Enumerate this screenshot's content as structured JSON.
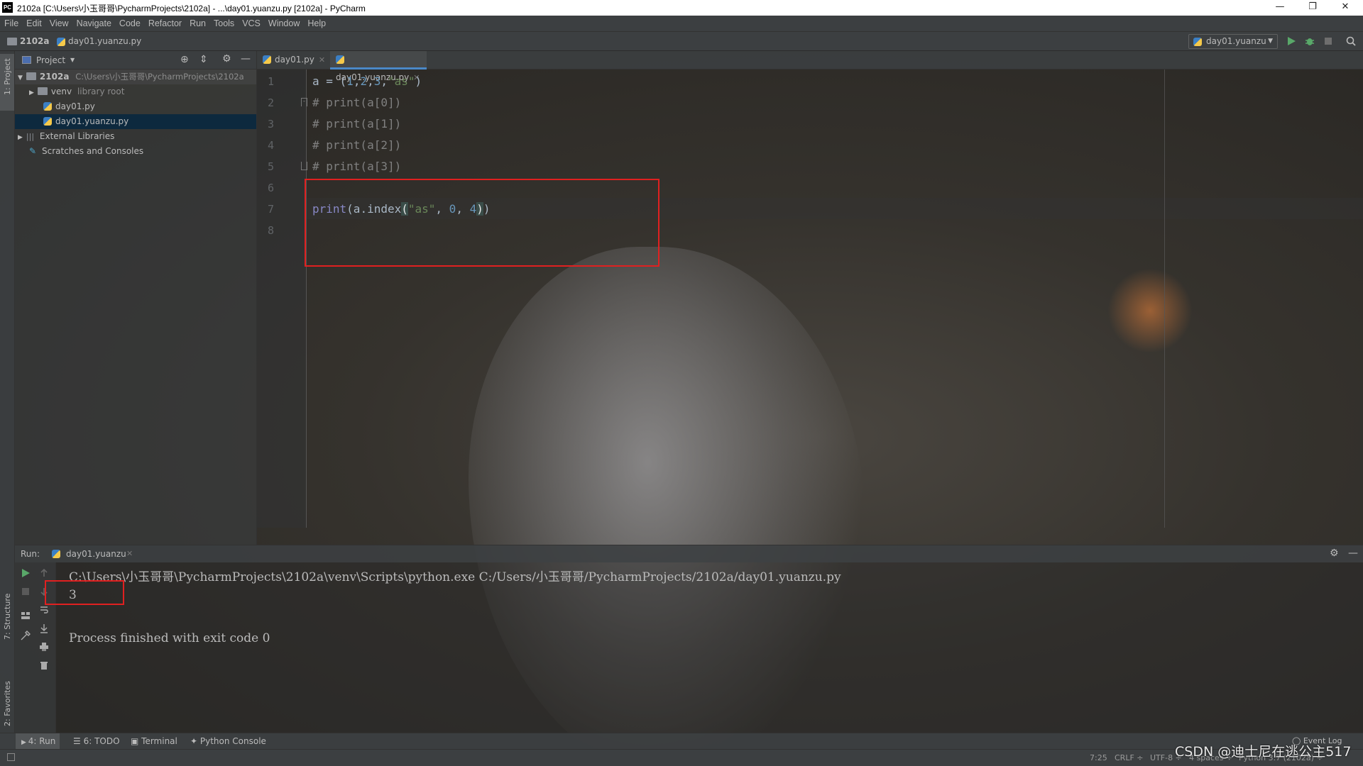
{
  "window": {
    "app_logo": "PC",
    "title": "2102a [C:\\Users\\小玉哥哥\\PycharmProjects\\2102a] - ...\\day01.yuanzu.py [2102a] - PyCharm",
    "minimize": "—",
    "restore": "❐",
    "close": "✕"
  },
  "menu": [
    "File",
    "Edit",
    "View",
    "Navigate",
    "Code",
    "Refactor",
    "Run",
    "Tools",
    "VCS",
    "Window",
    "Help"
  ],
  "navbar": {
    "project": "2102a",
    "file": "day01.yuanzu.py",
    "run_config": "day01.yuanzu",
    "icons": [
      "run-icon",
      "debug-icon",
      "stop-icon",
      "search-icon"
    ]
  },
  "left_strip": {
    "project_tab": "1: Project",
    "structure_tab": "7: Structure",
    "favorites_tab": "2: Favorites"
  },
  "project_panel": {
    "title": "Project",
    "tree": [
      {
        "label": "2102a",
        "extra": "C:\\Users\\小玉哥哥\\PycharmProjects\\2102a",
        "type": "folder",
        "expanded": true
      },
      {
        "label": "venv",
        "extra": "library root",
        "type": "folder",
        "expanded": false
      },
      {
        "label": "day01.py",
        "extra": "",
        "type": "python-file"
      },
      {
        "label": "day01.yuanzu.py",
        "extra": "",
        "type": "python-file",
        "selected": true
      },
      {
        "label": "External Libraries",
        "extra": "",
        "type": "libraries",
        "expanded": false
      },
      {
        "label": "Scratches and Consoles",
        "extra": "",
        "type": "scratches"
      }
    ]
  },
  "editor": {
    "tabs": [
      {
        "label": "day01.py",
        "active": false
      },
      {
        "label": "day01.yuanzu.py",
        "active": true
      }
    ],
    "line_numbers": [
      "1",
      "2",
      "3",
      "4",
      "5",
      "6",
      "7",
      "8"
    ],
    "code": {
      "l1": {
        "a": "a = (",
        "n1": "1",
        "c1": ",",
        "n2": "2",
        "c2": ",",
        "n3": "3",
        "c3": ",",
        "s": "\"as\"",
        "close": ")"
      },
      "l2": "# print(a[0])",
      "l3": "# print(a[1])",
      "l4": "# print(a[2])",
      "l5": "# print(a[3])",
      "l7": {
        "fn": "print",
        "mid": "(a.index",
        "open": "(",
        "s": "\"as\"",
        "c": ", ",
        "n0": "0",
        "c2": ", ",
        "n4": "4",
        "close1": ")",
        "close2": ")"
      }
    },
    "cursor_position": "7:25",
    "highlight_color": "#e02020"
  },
  "run_panel": {
    "label": "Run:",
    "tab": "day01.yuanzu",
    "command": "C:\\Users\\小玉哥哥\\PycharmProjects\\2102a\\venv\\Scripts\\python.exe C:/Users/小玉哥哥/PycharmProjects/2102a/day01.yuanzu.py",
    "result": "3",
    "exit_message": "Process finished with exit code 0"
  },
  "bottom_tools": [
    "4: Run",
    "6: TODO",
    "Terminal",
    "Python Console",
    "Event Log"
  ],
  "status_bar": {
    "position": "7:25",
    "line_sep": "CRLF ÷",
    "encoding": "UTF-8 ÷",
    "indent": "4 spaces ÷",
    "interpreter": "Python 3.7 (2102a) ÷"
  },
  "watermark": "CSDN @迪士尼在逃公主517"
}
